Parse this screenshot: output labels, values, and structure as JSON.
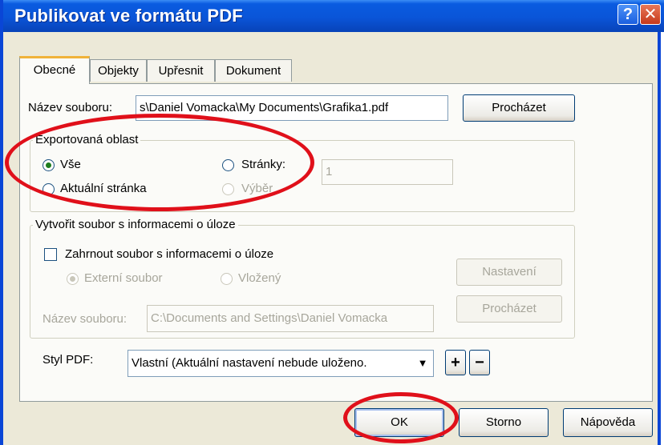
{
  "window": {
    "title": "Publikovat ve formátu PDF",
    "help_symbol": "?",
    "close_symbol": "✕"
  },
  "tabs": [
    {
      "label": "Obecné",
      "active": true
    },
    {
      "label": "Objekty",
      "active": false
    },
    {
      "label": "Upřesnit",
      "active": false
    },
    {
      "label": "Dokument",
      "active": false
    }
  ],
  "file": {
    "label": "Název souboru:",
    "value": "s\\Daniel Vomacka\\My Documents\\Grafika1.pdf",
    "browse_label": "Procházet"
  },
  "export_area": {
    "title": "Exportovaná oblast",
    "all_label": "Vše",
    "current_label": "Aktuální stránka",
    "pages_label": "Stránky:",
    "selection_label": "Výběr",
    "pages_value": "1",
    "selected": "all"
  },
  "job_info": {
    "title": "Vytvořit soubor s informacemi o úloze",
    "include_label": "Zahrnout soubor s informacemi o úloze",
    "include_checked": false,
    "external_label": "Externí soubor",
    "embedded_label": "Vložený",
    "settings_label": "Nastavení",
    "file_label": "Název souboru:",
    "file_value": "C:\\Documents and Settings\\Daniel Vomacka",
    "browse_label": "Procházet"
  },
  "pdf_style": {
    "label": "Styl PDF:",
    "value": "Vlastní (Aktuální nastavení nebude uloženo.",
    "add_symbol": "+",
    "remove_symbol": "−"
  },
  "footer": {
    "ok_label": "OK",
    "cancel_label": "Storno",
    "help_label": "Nápověda"
  },
  "colors": {
    "titlebar": "#0a55d8",
    "dialog_bg": "#ece9d8",
    "annotation": "#e0101a",
    "radio_dot": "#1d7c1d"
  },
  "icons": {
    "dropdown": "chevron-down-icon"
  }
}
